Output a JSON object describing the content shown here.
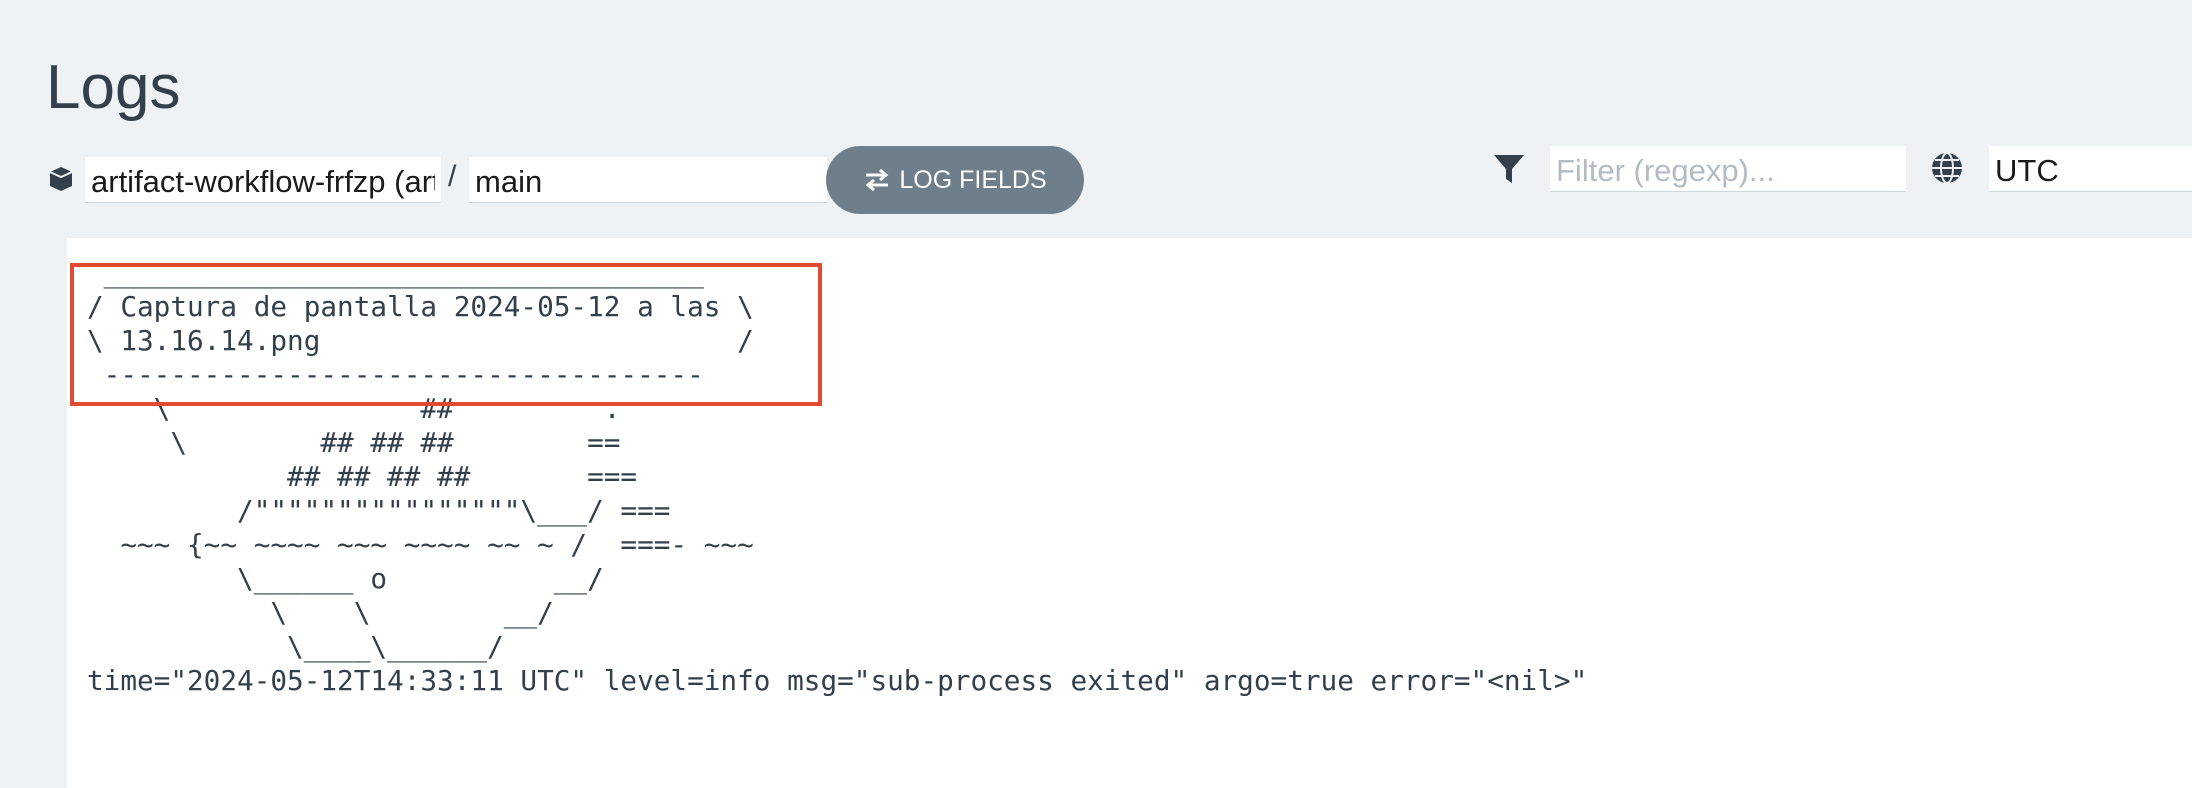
{
  "page": {
    "title": "Logs"
  },
  "toolbar": {
    "workflow_value": "artifact-workflow-frfzp (artifact-workflow-frfzp)",
    "separator": "/",
    "container_value": "main",
    "log_fields_label": "LOG FIELDS",
    "filter_placeholder": "Filter (regexp)...",
    "timezone_value": "UTC"
  },
  "icons": {
    "workflow": "cube-icon",
    "log_fields": "swap-arrows-icon",
    "filter": "funnel-icon",
    "timezone": "globe-icon"
  },
  "log": {
    "lines": [
      " ____________________________________",
      "/ Captura de pantalla 2024-05-12 a las \\",
      "\\ 13.16.14.png                         /",
      " ------------------------------------",
      "    \\               ##         .",
      "     \\        ## ## ##        ==",
      "            ## ## ## ##       ===",
      "         /\"\"\"\"\"\"\"\"\"\"\"\"\"\"\"\"\\___/ ===",
      "  ~~~ {~~ ~~~~ ~~~ ~~~~ ~~ ~ /  ===- ~~~",
      "         \\______ o          __/",
      "           \\    \\        __/",
      "            \\____\\______/",
      "time=\"2024-05-12T14:33:11 UTC\" level=info msg=\"sub-process exited\" argo=true error=\"<nil>\""
    ]
  },
  "colors": {
    "background": "#eef2f5",
    "panel": "#ffffff",
    "text": "#33404c",
    "button": "#6e7e8b",
    "highlight": "#e04b32"
  }
}
